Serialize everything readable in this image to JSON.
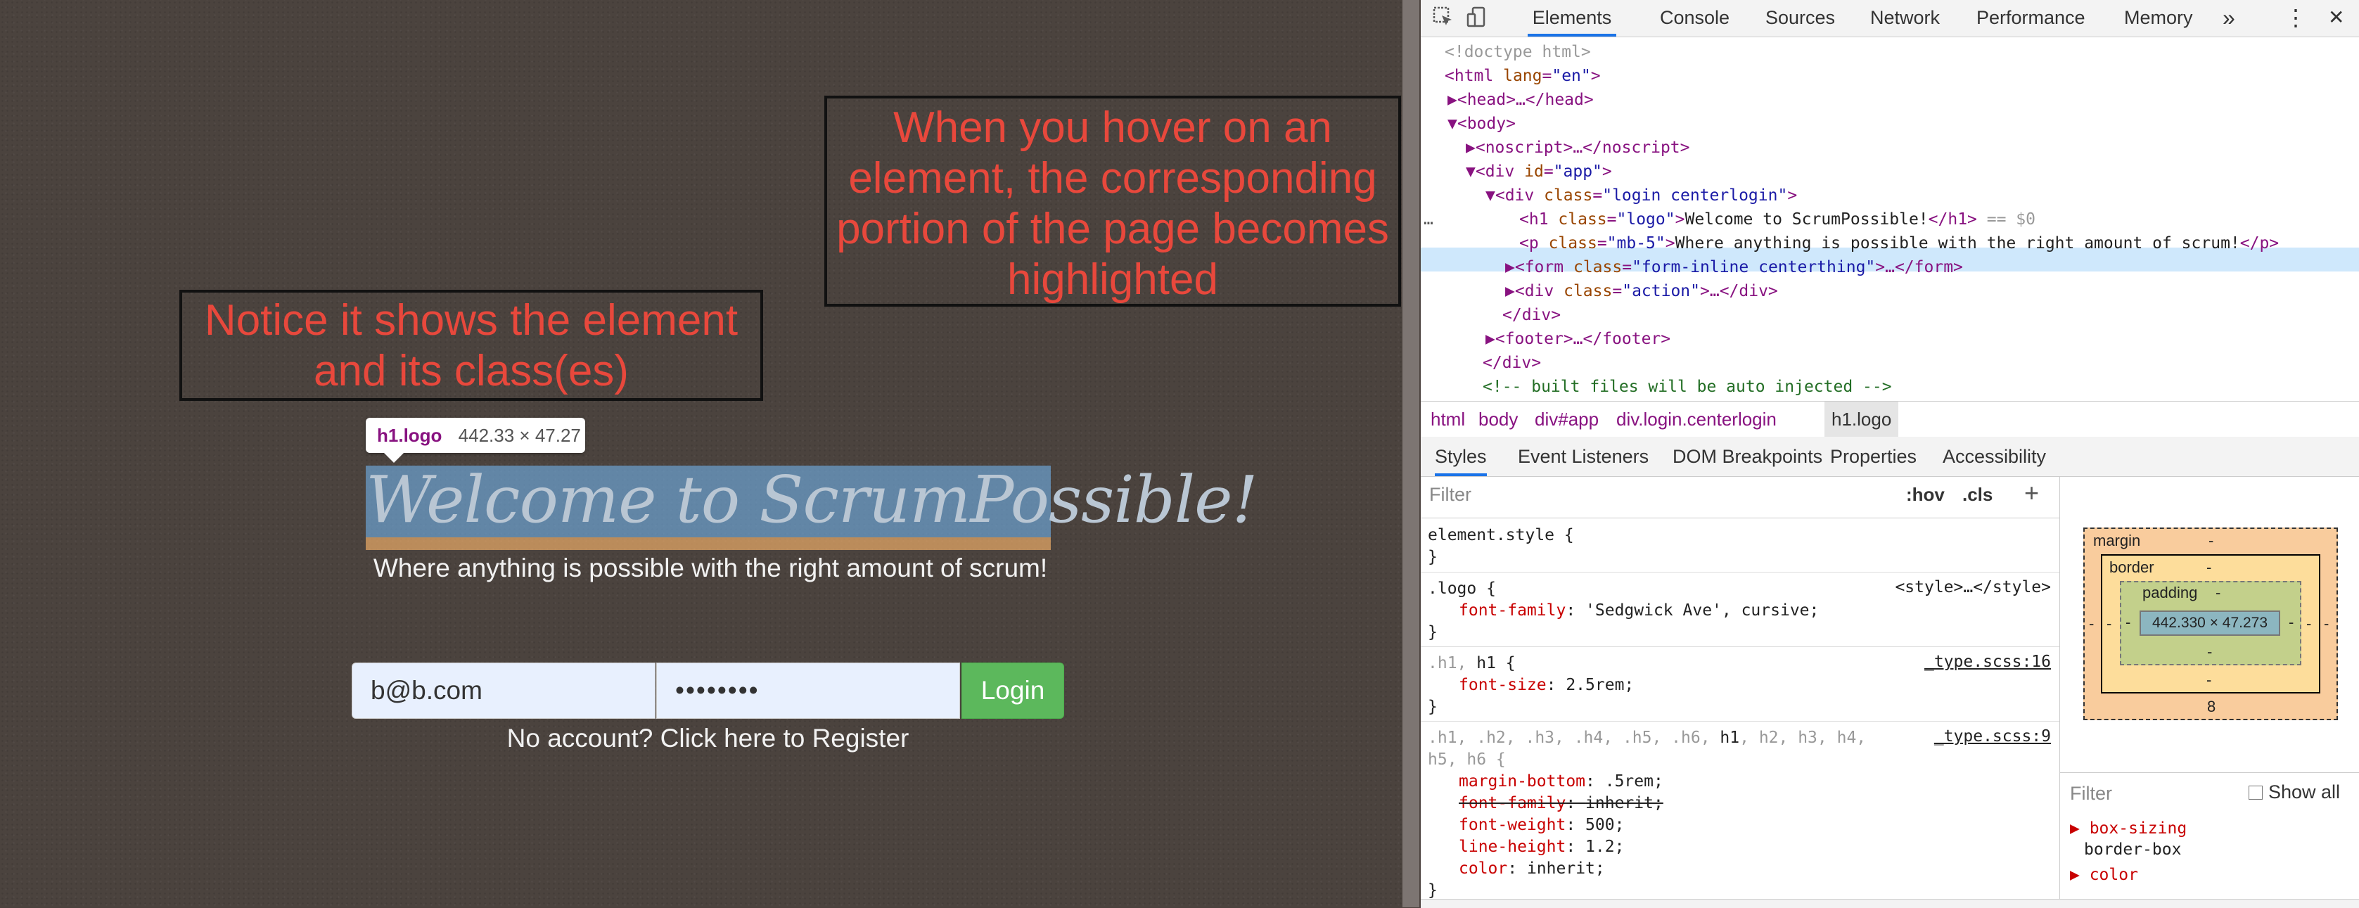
{
  "annotations": {
    "callout_top": "When you hover on an element, the corresponding portion of the page becomes highlighted",
    "callout_left": "Notice it shows the element and its class(es)"
  },
  "page": {
    "tooltip_selector": "h1.logo",
    "tooltip_size": "442.33 × 47.27",
    "logo_text": "Welcome to ScrumPossible!",
    "subtitle": "Where anything is possible with the right amount of scrum!",
    "email_value": "b@b.com",
    "password_value": "••••••••",
    "login_label": "Login",
    "register_link": "No account? Click here to Register"
  },
  "devtools": {
    "tabs": [
      "Elements",
      "Console",
      "Sources",
      "Network",
      "Performance",
      "Memory"
    ],
    "more_tabs": "»",
    "menu_icon": "⋮",
    "close_icon": "✕",
    "dom": {
      "doctype": "<!doctype html>",
      "html_open": "<html",
      "html_attr": "lang",
      "html_val": "\"en\"",
      "head": "<head>…</head>",
      "body": "<body>",
      "noscript": "<noscript>…</noscript>",
      "div_app_tag": "<div",
      "div_app_attr": "id",
      "div_app_val": "\"app\"",
      "div_login_tag": "<div",
      "div_login_attr": "class",
      "div_login_val": "\"login centerlogin\"",
      "h1_tag": "<h1",
      "h1_attr": "class",
      "h1_val": "\"logo\"",
      "h1_text": "Welcome to ScrumPossible!",
      "h1_close": "</h1>",
      "h1_eq": "== $0",
      "p_tag": "<p",
      "p_attr": "class",
      "p_val": "\"mb-5\"",
      "p_text": "Where anything is possible with the right amount of scrum!",
      "p_close": "</p>",
      "form_tag": "<form",
      "form_attr": "class",
      "form_val": "\"form-inline centerthing\"",
      "form_rest": ">…</form>",
      "div_action_tag": "<div",
      "div_action_attr": "class",
      "div_action_val": "\"action\"",
      "div_action_rest": ">…</div>",
      "div_close": "</div>",
      "footer": "<footer>…</footer>",
      "div_close2": "</div>",
      "comment": "<!-- built files will be auto injected -->"
    },
    "breadcrumbs": [
      "html",
      "body",
      "div#app",
      "div.login.centerlogin",
      "h1.logo"
    ],
    "style_tabs": [
      "Styles",
      "Event Listeners",
      "DOM Breakpoints",
      "Properties",
      "Accessibility"
    ],
    "styles_filter_placeholder": "Filter",
    "hov_label": ":hov",
    "cls_label": ".cls",
    "plus_label": "+",
    "rules": {
      "element_style": "element.style {",
      "element_close": "}",
      "logo_selector": ".logo {",
      "logo_source": "<style>…</style>",
      "logo_prop": "font-family",
      "logo_val": "'Sedgwick Ave', cursive;",
      "logo_close": "}",
      "h1_selector_dim": ".h1, ",
      "h1_selector": "h1 {",
      "h1_source": "_type.scss:16",
      "h1_prop": "font-size",
      "h1_val": "2.5rem;",
      "h1_close": "}",
      "headings_selector_dim1": ".h1, .h2, .h3, .h4, .h5, .h6, ",
      "headings_selector_h1": "h1",
      "headings_selector_dim2": ", h2, h3, h4,",
      "headings_selector_line2": "h5, h6 {",
      "headings_source": "_type.scss:9",
      "p1_name": "margin-bottom",
      "p1_val": ".5rem;",
      "p2_name": "font-family",
      "p2_val": "inherit;",
      "p3_name": "font-weight",
      "p3_val": "500;",
      "p4_name": "line-height",
      "p4_val": "1.2;",
      "p5_name": "color",
      "p5_val": "inherit;",
      "headings_close": "}"
    },
    "box_model": {
      "margin_label": "margin",
      "margin_value": "-",
      "margin_bottom": "8",
      "margin_left": "-",
      "margin_right": "-",
      "border_label": "border",
      "border_value": "-",
      "border_bottom": "-",
      "border_left": "-",
      "border_right": "-",
      "padding_label": "padding",
      "padding_value": "-",
      "padding_bottom": "-",
      "padding_left": "-",
      "padding_right": "-",
      "content": "442.330 × 47.273"
    },
    "computed": {
      "filter_placeholder": "Filter",
      "show_all": "Show all",
      "prop1": "box-sizing",
      "val1": "border-box",
      "prop2": "color"
    }
  }
}
